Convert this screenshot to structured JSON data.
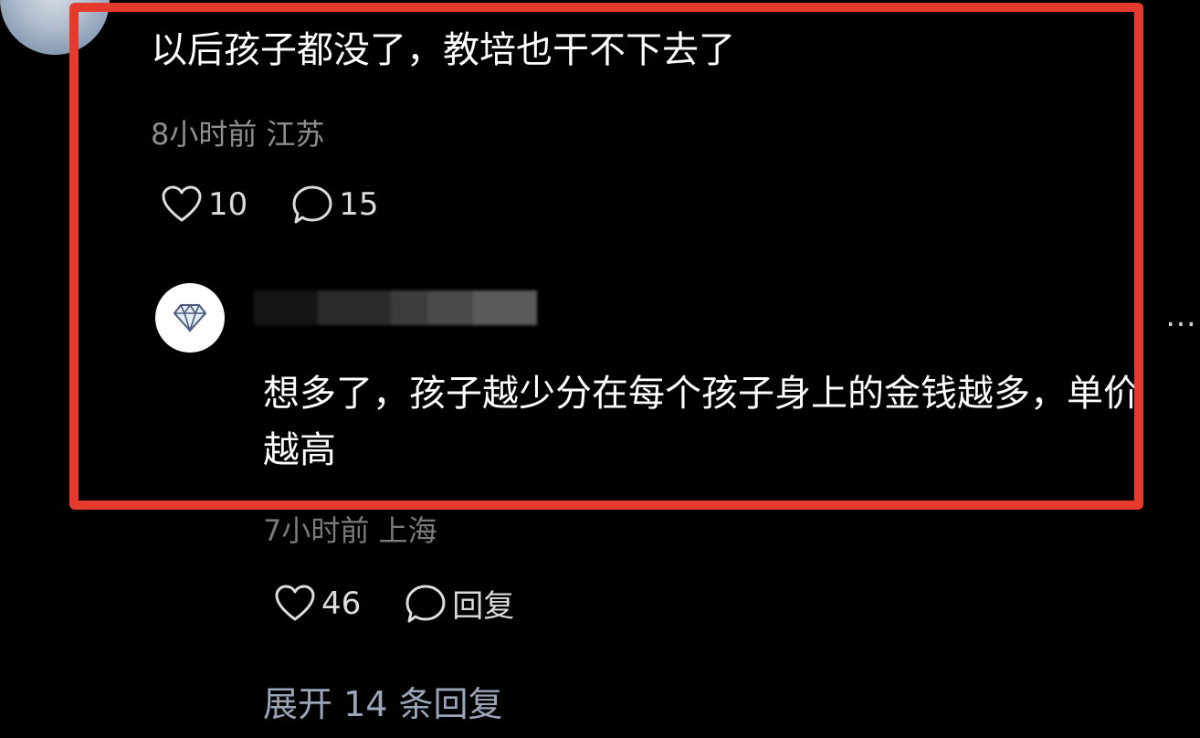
{
  "top_comment": {
    "text": "以后孩子都没了，教培也干不下去了",
    "meta": "8小时前 江苏",
    "likes": "10",
    "replies": "15"
  },
  "reply": {
    "text": "想多了，孩子越少分在每个孩子身上的金钱越多，单价越高",
    "meta": "7小时前 上海",
    "likes": "46",
    "reply_label": "回复"
  },
  "more_menu": "…",
  "expand_label": "展开 14 条回复",
  "colors": {
    "highlight_border": "#e53b2c",
    "background": "#000000"
  },
  "icons": {
    "like": "heart-outline-icon",
    "comment": "speech-bubble-icon",
    "badge": "diamond-icon"
  }
}
